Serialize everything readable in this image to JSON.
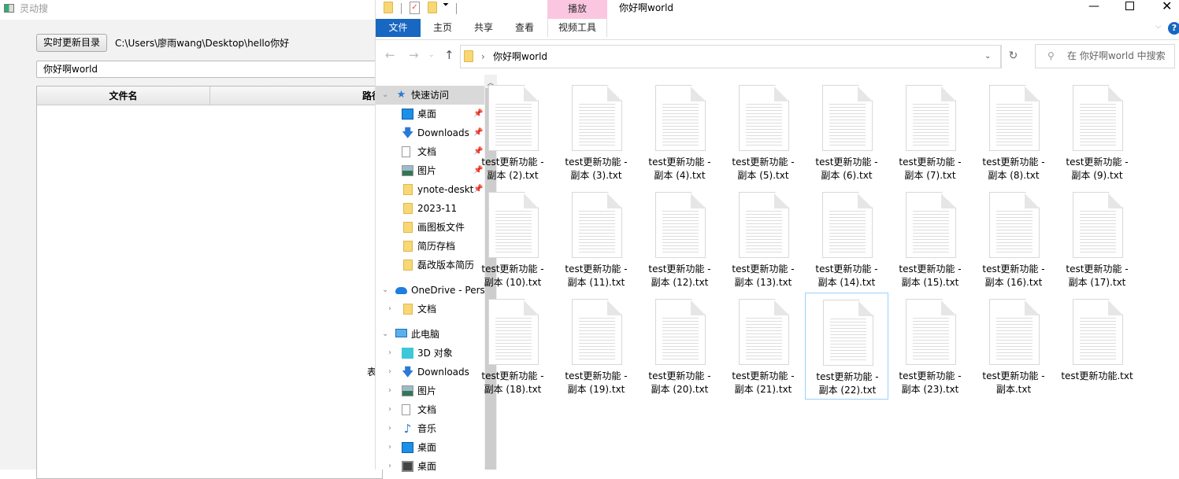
{
  "app": {
    "title": "灵动搜",
    "refresh_button": "实时更新目录",
    "path": "C:\\Users\\廖雨wang\\Desktop\\hello你好",
    "search_value": "你好啊world",
    "columns": [
      "文件名",
      "路径"
    ],
    "empty_text": "表"
  },
  "explorer": {
    "window_title": "你好啊world",
    "context_tab": "播放",
    "tabs": [
      "文件",
      "主页",
      "共享",
      "查看",
      "视频工具"
    ],
    "address": "你好啊world",
    "search_placeholder": "在 你好啊world 中搜索",
    "nav": [
      {
        "label": "快速访问",
        "icon": "star-icon",
        "expanded": true,
        "level": 0,
        "selected": true
      },
      {
        "label": "桌面",
        "icon": "desktop-icon",
        "pinned": true,
        "level": 1
      },
      {
        "label": "Downloads",
        "icon": "download-icon",
        "pinned": true,
        "level": 1
      },
      {
        "label": "文档",
        "icon": "document-icon",
        "pinned": true,
        "level": 1
      },
      {
        "label": "图片",
        "icon": "picture-icon",
        "pinned": true,
        "level": 1
      },
      {
        "label": "ynote-deskt",
        "icon": "folder-icon",
        "pinned": true,
        "level": 1
      },
      {
        "label": "2023-11",
        "icon": "folder-icon",
        "level": 1
      },
      {
        "label": "画图板文件",
        "icon": "folder-icon",
        "level": 1
      },
      {
        "label": "简历存档",
        "icon": "folder-icon",
        "level": 1
      },
      {
        "label": "磊改版本简历",
        "icon": "folder-icon",
        "level": 1
      },
      {
        "label": "OneDrive - Pers",
        "icon": "cloud-icon",
        "expanded": true,
        "level": 0
      },
      {
        "label": "文档",
        "icon": "folder-icon",
        "level": 1
      },
      {
        "label": "此电脑",
        "icon": "computer-icon",
        "expanded": true,
        "level": 0
      },
      {
        "label": "3D 对象",
        "icon": "cube-icon",
        "level": 1
      },
      {
        "label": "Downloads",
        "icon": "download-icon",
        "level": 1
      },
      {
        "label": "图片",
        "icon": "picture-icon",
        "level": 1
      },
      {
        "label": "文档",
        "icon": "document-icon",
        "level": 1
      },
      {
        "label": "音乐",
        "icon": "music-icon",
        "level": 1
      },
      {
        "label": "桌面",
        "icon": "desktop-icon",
        "level": 1
      },
      {
        "label": "桌面",
        "icon": "video-icon",
        "level": 1
      }
    ],
    "files": [
      [
        "test更新功能 -",
        "副本 (2).txt"
      ],
      [
        "test更新功能 -",
        "副本 (3).txt"
      ],
      [
        "test更新功能 -",
        "副本 (4).txt"
      ],
      [
        "test更新功能 -",
        "副本 (5).txt"
      ],
      [
        "test更新功能 -",
        "副本 (6).txt"
      ],
      [
        "test更新功能 -",
        "副本 (7).txt"
      ],
      [
        "test更新功能 -",
        "副本 (8).txt"
      ],
      [
        "test更新功能 -",
        "副本 (9).txt"
      ],
      [
        "test更新功能 -",
        "副本 (10).txt"
      ],
      [
        "test更新功能 -",
        "副本 (11).txt"
      ],
      [
        "test更新功能 -",
        "副本 (12).txt"
      ],
      [
        "test更新功能 -",
        "副本 (13).txt"
      ],
      [
        "test更新功能 -",
        "副本 (14).txt"
      ],
      [
        "test更新功能 -",
        "副本 (15).txt"
      ],
      [
        "test更新功能 -",
        "副本 (16).txt"
      ],
      [
        "test更新功能 -",
        "副本 (17).txt"
      ],
      [
        "test更新功能 -",
        "副本 (18).txt"
      ],
      [
        "test更新功能 -",
        "副本 (19).txt"
      ],
      [
        "test更新功能 -",
        "副本 (20).txt"
      ],
      [
        "test更新功能 -",
        "副本 (21).txt"
      ],
      [
        "test更新功能 -",
        "副本 (22).txt"
      ],
      [
        "test更新功能 -",
        "副本 (23).txt"
      ],
      [
        "test更新功能 -",
        "副本.txt"
      ],
      [
        "test更新功能.txt"
      ]
    ],
    "selected_file_index": 20,
    "colors": {
      "file_tab": "#1867c0",
      "context_tab": "#fbc7e0",
      "selection_border": "#99d1ff"
    }
  }
}
